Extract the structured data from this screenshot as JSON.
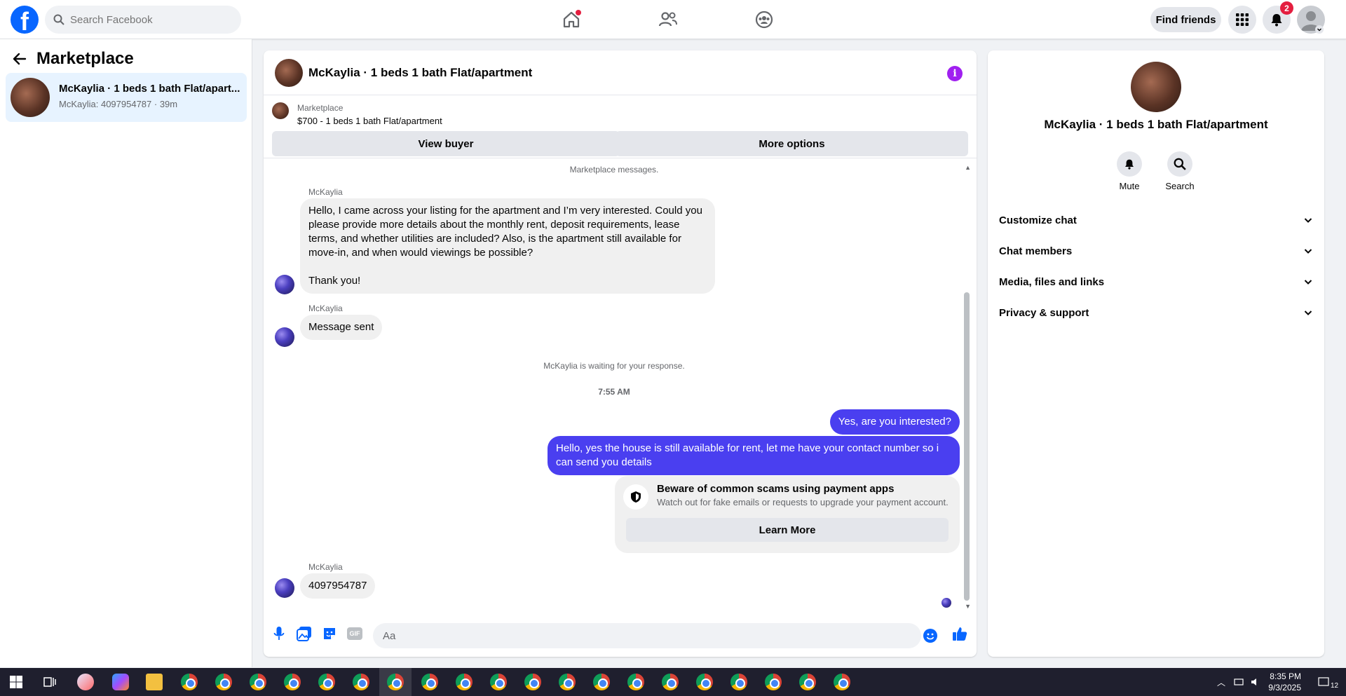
{
  "topbar": {
    "logo_letter": "f",
    "search_placeholder": "Search Facebook",
    "find_friends": "Find friends",
    "notification_count": "2"
  },
  "left": {
    "title": "Marketplace",
    "conversation": {
      "name": "McKaylia · 1 beds 1 bath Flat/apart...",
      "subtitle": "McKaylia: 4097954787 · 39m"
    }
  },
  "chat": {
    "title": "McKaylia · 1 beds 1 bath Flat/apartment",
    "listing_source": "Marketplace",
    "listing_price": "$700 - 1 beds 1 bath Flat/apartment",
    "view_buyer": "View buyer",
    "more_options": "More options",
    "system_top": "Marketplace messages.",
    "sender_name": "McKaylia",
    "msg1": "Hello, I came across your listing for the apartment and I’m very interested. Could you please provide more details about the monthly rent, deposit requirements, lease terms, and whether utilities are included? Also, is the apartment still available for move-in, and when would viewings be possible?",
    "msg1_thanks": "Thank you!",
    "msg2": "Message sent",
    "waiting": "McKaylia is waiting for your response.",
    "time": "7:55 AM",
    "out1": "Yes, are you interested?",
    "out2": "Hello, yes the house is still available for rent, let me have your contact number so i can send you details",
    "scam_title": "Beware of common scams using payment apps",
    "scam_sub": "Watch out for fake emails or requests to upgrade your payment account.",
    "learn_more": "Learn More",
    "msg3": "4097954787",
    "composer_placeholder": "Aa",
    "gif_label": "GIF"
  },
  "right": {
    "name": "McKaylia · 1 beds 1 bath Flat/apartment",
    "mute": "Mute",
    "search": "Search",
    "sections": [
      "Customize chat",
      "Chat members",
      "Media, files and links",
      "Privacy & support"
    ]
  },
  "taskbar": {
    "time": "8:35 PM",
    "date": "9/3/2025",
    "notif": "12"
  },
  "colors": {
    "brand": "#0866ff",
    "outgoing_bubble": "#4a3ff0",
    "info_icon": "#a020f0"
  }
}
